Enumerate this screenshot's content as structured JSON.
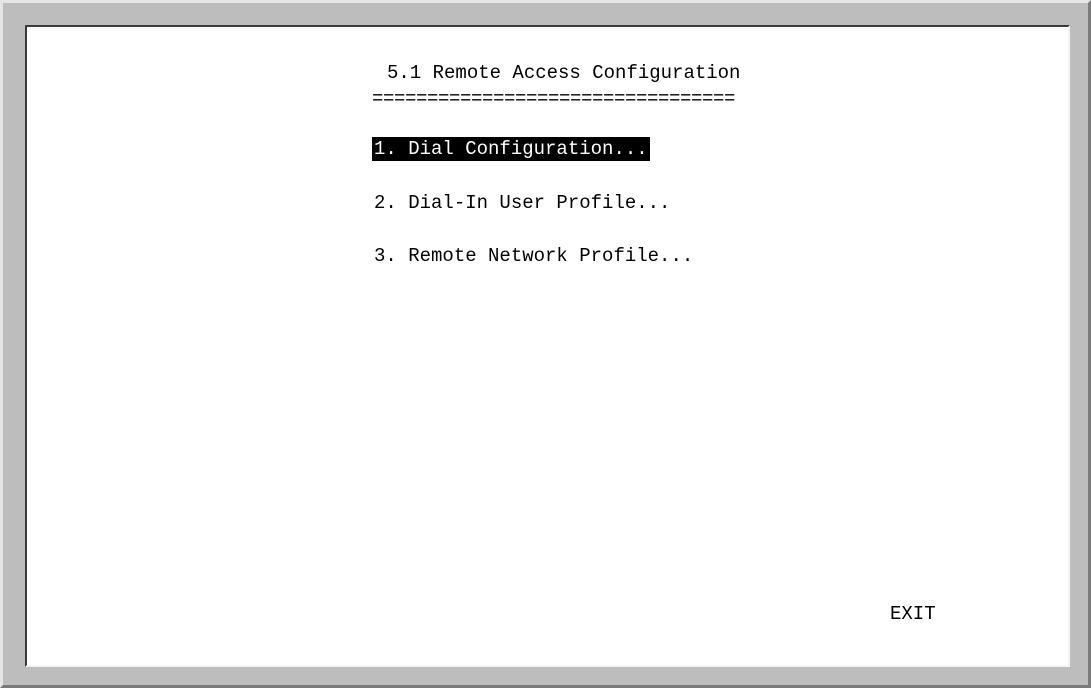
{
  "screen": {
    "title": "5.1 Remote Access Configuration",
    "rule": "================================="
  },
  "menu": {
    "items": [
      {
        "label": "1. Dial Configuration...",
        "selected": true
      },
      {
        "label": "2. Dial-In User Profile...",
        "selected": false
      },
      {
        "label": "3. Remote Network Profile...",
        "selected": false
      }
    ]
  },
  "footer": {
    "exit_label": "EXIT"
  },
  "colors": {
    "background": "#ffffff",
    "text": "#000000",
    "selection_background": "#000000",
    "selection_text": "#ffffff",
    "frame": "#bdbdbd"
  }
}
